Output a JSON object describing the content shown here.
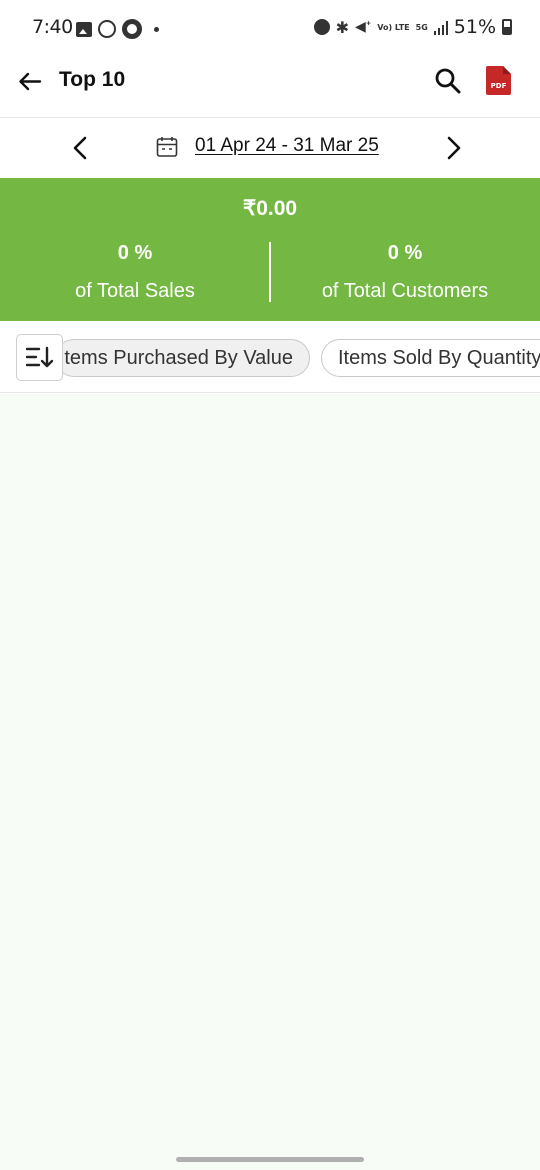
{
  "status": {
    "time": "7:40",
    "battery": "51%",
    "network": "5G",
    "volte": "Vo) LTE"
  },
  "header": {
    "title": "Top 10"
  },
  "date_range": {
    "label": "01 Apr 24 - 31 Mar 25"
  },
  "summary": {
    "total": "₹0.00",
    "left_value": "0 %",
    "left_label": "of Total Sales",
    "right_value": "0 %",
    "right_label": "of Total Customers"
  },
  "filters": {
    "chips": [
      "Items Purchased By Value",
      "Items Sold By Quantity"
    ]
  },
  "icons": [
    "back-arrow-icon",
    "search-icon",
    "pdf-icon",
    "chevron-left-icon",
    "calendar-icon",
    "chevron-right-icon",
    "sort-icon"
  ],
  "colors": {
    "summary_bg": "#74b843",
    "pdf_red": "#c62828",
    "content_bg": "#f7fcf7"
  }
}
